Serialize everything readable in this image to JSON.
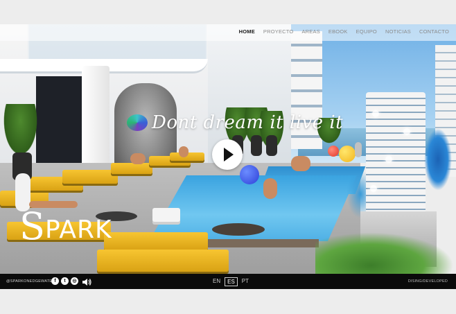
{
  "nav": {
    "items": [
      {
        "label": "HOME",
        "active": true
      },
      {
        "label": "PROYECTO",
        "active": false
      },
      {
        "label": "AREAS",
        "active": false
      },
      {
        "label": "EBOOK",
        "active": false
      },
      {
        "label": "EQUIPO",
        "active": false
      },
      {
        "label": "NOTICIAS",
        "active": false
      },
      {
        "label": "CONTACTO",
        "active": false
      }
    ]
  },
  "hero": {
    "tagline": "Dont dream it live it"
  },
  "brand": {
    "initial": "S",
    "rest": "PARK"
  },
  "footer": {
    "handle": "@SPARKONEDGEWATER",
    "social": [
      {
        "name": "facebook-icon",
        "glyph": "f"
      },
      {
        "name": "twitter-icon",
        "glyph": "t"
      },
      {
        "name": "instagram-icon",
        "glyph": "◎"
      }
    ],
    "languages": [
      {
        "code": "EN",
        "active": false
      },
      {
        "code": "ES",
        "active": true
      },
      {
        "code": "PT",
        "active": false
      }
    ],
    "credits": "DISING/DEVELOPED"
  },
  "colors": {
    "accent_dark": "#0b0b0b",
    "lounger_yellow": "#f7c531",
    "pool_blue": "#3aa3e0"
  }
}
